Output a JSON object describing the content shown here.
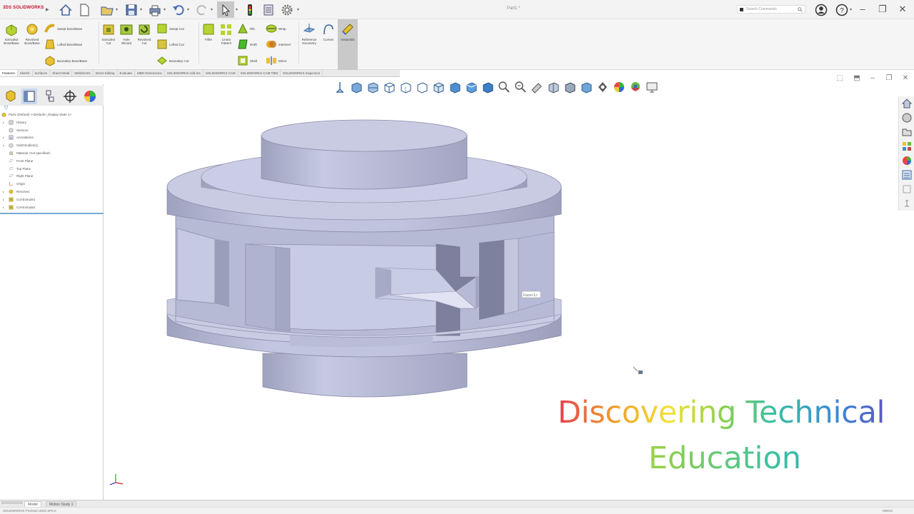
{
  "app": {
    "brand_prefix": "3DS",
    "brand": "SOLIDWORKS",
    "document_title": "Part1 *",
    "search_placeholder": "Search Commands"
  },
  "ribbon": {
    "large_buttons": [
      {
        "label": "Extruded Boss/Base",
        "icon": "extruded-boss-icon"
      },
      {
        "label": "Revolved Boss/Base",
        "icon": "revolved-boss-icon"
      },
      {
        "label": "Extruded Cut",
        "icon": "extruded-cut-icon"
      },
      {
        "label": "Hole Wizard",
        "icon": "hole-wizard-icon"
      },
      {
        "label": "Revolved Cut",
        "icon": "revolved-cut-icon"
      },
      {
        "label": "Fillet",
        "icon": "fillet-icon"
      },
      {
        "label": "Linear Pattern",
        "icon": "linear-pattern-icon"
      },
      {
        "label": "Reference Geometry",
        "icon": "reference-geometry-icon"
      },
      {
        "label": "Curves",
        "icon": "curves-icon"
      },
      {
        "label": "Instant3D",
        "icon": "instant3d-icon"
      }
    ],
    "small_buttons": [
      {
        "label": "Swept Boss/Base"
      },
      {
        "label": "Lofted Boss/Base"
      },
      {
        "label": "Boundary Boss/Base"
      },
      {
        "label": "Swept Cut"
      },
      {
        "label": "Lofted Cut"
      },
      {
        "label": "Boundary Cut"
      },
      {
        "label": "Rib"
      },
      {
        "label": "Wrap"
      },
      {
        "label": "Draft"
      },
      {
        "label": "Intersect"
      },
      {
        "label": "Shell"
      },
      {
        "label": "Mirror"
      }
    ]
  },
  "command_tabs": [
    "Features",
    "Sketch",
    "Surfaces",
    "Sheet Metal",
    "Weldments",
    "Direct Editing",
    "Evaluate",
    "MBD Dimensions",
    "SOLIDWORKS Add-Ins",
    "SOLIDWORKS CAM",
    "SOLIDWORKS CAM TBM",
    "SOLIDWORKS Inspection"
  ],
  "feature_tree": {
    "root": "Part1 (Default) <<Default>_Display State 1>",
    "items": [
      {
        "label": "History",
        "icon": "history-icon",
        "expandable": true
      },
      {
        "label": "Sensors",
        "icon": "sensors-icon",
        "expandable": false
      },
      {
        "label": "Annotations",
        "icon": "annotations-icon",
        "expandable": true
      },
      {
        "label": "Solid Bodies(1)",
        "icon": "solid-bodies-icon",
        "expandable": true
      },
      {
        "label": "Material <not specified>",
        "icon": "material-icon",
        "expandable": false
      },
      {
        "label": "Front Plane",
        "icon": "plane-icon",
        "expandable": false
      },
      {
        "label": "Top Plane",
        "icon": "plane-icon",
        "expandable": false
      },
      {
        "label": "Right Plane",
        "icon": "plane-icon",
        "expandable": false
      },
      {
        "label": "Origin",
        "icon": "origin-icon",
        "expandable": false
      },
      {
        "label": "Revolve1",
        "icon": "revolve-feature-icon",
        "expandable": true
      },
      {
        "label": "Cut-Extrude1",
        "icon": "cut-extrude-icon",
        "expandable": true
      },
      {
        "label": "Cut-Extrude2",
        "icon": "cut-extrude-icon",
        "expandable": true
      }
    ]
  },
  "viewport": {
    "face_tag": "Face<1>",
    "watermark_line1": "Discovering Technical",
    "watermark_line2": "Education"
  },
  "bottom_tabs": [
    "Model",
    "Motion Study 1"
  ],
  "status": {
    "left": "SOLIDWORKS Premium 2022 SP0.0",
    "right": "MMGS"
  },
  "colors": {
    "model_face": "#c9cbe3",
    "model_side": "#a8abc6",
    "model_dark": "#8a8daa",
    "accent_blue": "#3a8bd0",
    "ribbon_bg": "#f5f5f5"
  }
}
